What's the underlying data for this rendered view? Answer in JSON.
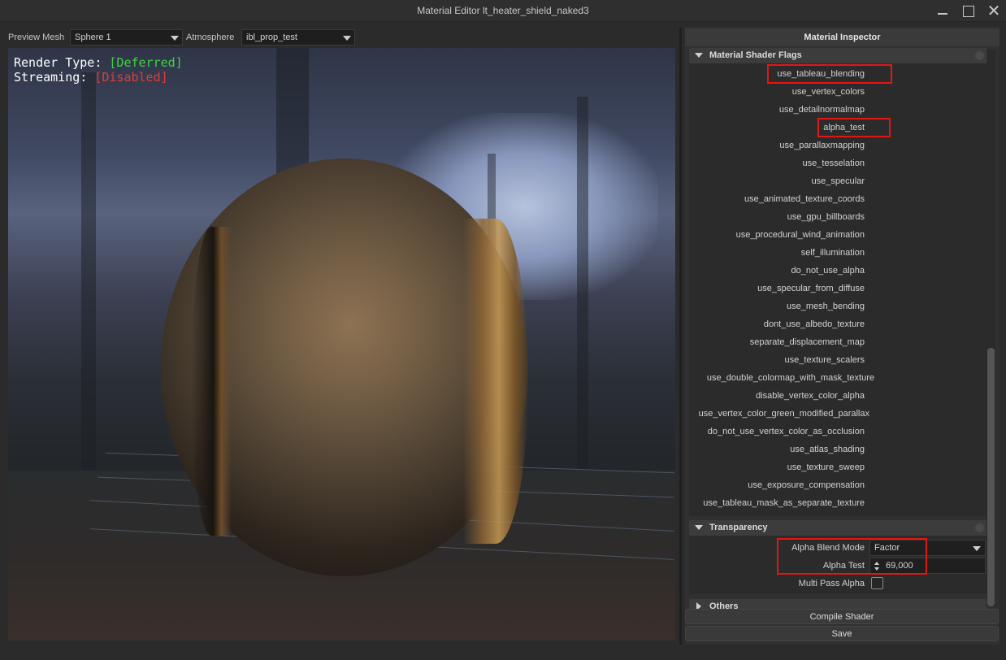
{
  "window": {
    "title": "Material Editor lt_heater_shield_naked3"
  },
  "toolbar": {
    "preview_mesh_label": "Preview Mesh",
    "preview_mesh_value": "Sphere 1",
    "atmosphere_label": "Atmosphere",
    "atmosphere_value": "ibl_prop_test"
  },
  "viewport": {
    "render_type_label": "Render Type: ",
    "render_type_value": "[Deferred]",
    "streaming_label": "Streaming: ",
    "streaming_value": "[Disabled]",
    "colors": {
      "ok": "#3fd33f",
      "bad": "#e23b3b"
    }
  },
  "inspector": {
    "title": "Material Inspector",
    "shader_flags": {
      "title": "Material Shader Flags",
      "flags": [
        {
          "label": "use_tableau_blending",
          "checked": true
        },
        {
          "label": "use_vertex_colors",
          "checked": false
        },
        {
          "label": "use_detailnormalmap",
          "checked": false
        },
        {
          "label": "alpha_test",
          "checked": true
        },
        {
          "label": "use_parallaxmapping",
          "checked": false
        },
        {
          "label": "use_tesselation",
          "checked": false
        },
        {
          "label": "use_specular",
          "checked": true
        },
        {
          "label": "use_animated_texture_coords",
          "checked": false
        },
        {
          "label": "use_gpu_billboards",
          "checked": false
        },
        {
          "label": "use_procedural_wind_animation",
          "checked": false
        },
        {
          "label": "self_illumination",
          "checked": false
        },
        {
          "label": "do_not_use_alpha",
          "checked": false
        },
        {
          "label": "use_specular_from_diffuse",
          "checked": false
        },
        {
          "label": "use_mesh_bending",
          "checked": false
        },
        {
          "label": "dont_use_albedo_texture",
          "checked": false
        },
        {
          "label": "separate_displacement_map",
          "checked": false
        },
        {
          "label": "use_texture_scalers",
          "checked": false
        },
        {
          "label": "use_double_colormap_with_mask_texture",
          "checked": false
        },
        {
          "label": "disable_vertex_color_alpha",
          "checked": false
        },
        {
          "label": "use_vertex_color_green_modified_parallax",
          "checked": false
        },
        {
          "label": "do_not_use_vertex_color_as_occlusion",
          "checked": false
        },
        {
          "label": "use_atlas_shading",
          "checked": false
        },
        {
          "label": "use_texture_sweep",
          "checked": false
        },
        {
          "label": "use_exposure_compensation",
          "checked": false
        },
        {
          "label": "use_tableau_mask_as_separate_texture",
          "checked": false
        }
      ]
    },
    "transparency": {
      "title": "Transparency",
      "alpha_blend_mode_label": "Alpha Blend Mode",
      "alpha_blend_mode_value": "Factor",
      "alpha_test_label": "Alpha Test",
      "alpha_test_value": "69,000",
      "multi_pass_alpha_label": "Multi Pass Alpha",
      "multi_pass_alpha_checked": false
    },
    "others": {
      "title": "Others"
    },
    "compile_button": "Compile Shader",
    "save_button": "Save"
  }
}
